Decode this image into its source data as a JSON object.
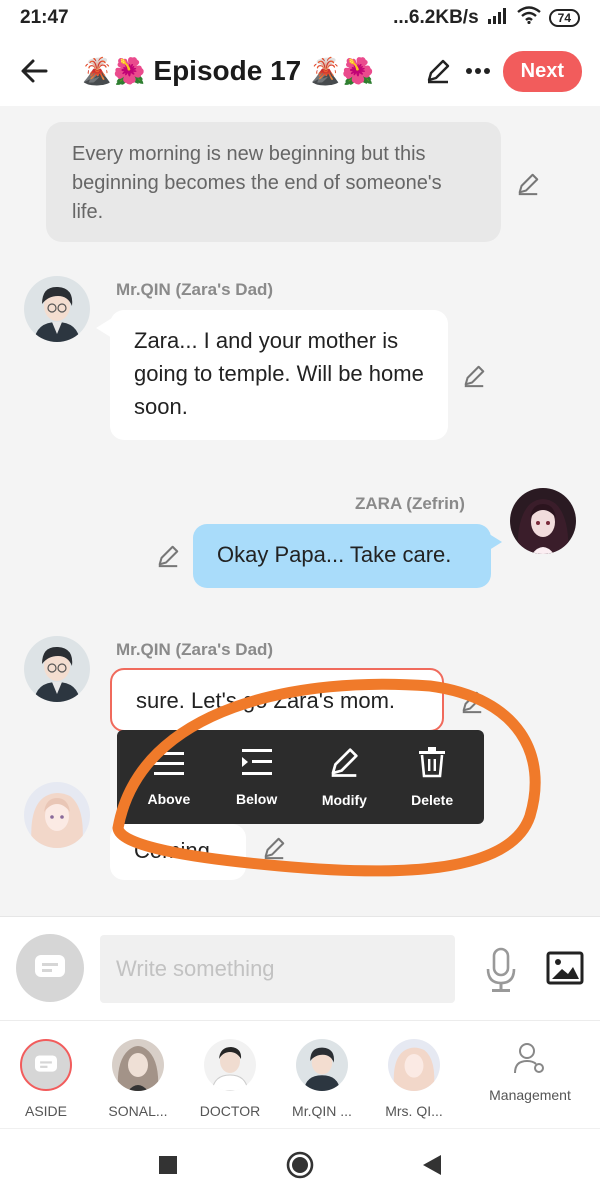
{
  "status_bar": {
    "time": "21:47",
    "network_speed": "...6.2KB/s",
    "battery": "74"
  },
  "header": {
    "title": "Episode 17",
    "title_emoji": "🌋🌺",
    "next_label": "Next"
  },
  "chat": {
    "narration": "Every morning is new beginning but this beginning becomes the end of someone's life.",
    "messages": [
      {
        "speaker": "Mr.QIN (Zara's Dad)",
        "text": "Zara... I and your mother is going to temple. Will be home soon."
      },
      {
        "speaker": "ZARA (Zefrin)",
        "text": "Okay Papa... Take care."
      },
      {
        "speaker": "Mr.QIN (Zara's Dad)",
        "text": "sure. Let's go Zara's mom."
      },
      {
        "speaker": "",
        "text": "Coming."
      }
    ]
  },
  "context_menu": {
    "items": [
      "Above",
      "Below",
      "Modify",
      "Delete"
    ]
  },
  "input": {
    "placeholder": "Write something"
  },
  "characters": [
    {
      "label": "ASIDE"
    },
    {
      "label": "SONAL..."
    },
    {
      "label": "DOCTOR"
    },
    {
      "label": "Mr.QIN ..."
    },
    {
      "label": "Mrs. QI..."
    }
  ],
  "management_label": "Management",
  "colors": {
    "accent": "#f25c5c",
    "blue_bubble": "#a9dcfa",
    "annotation": "#f07a2a",
    "menu_bg": "#2c2c2c"
  }
}
